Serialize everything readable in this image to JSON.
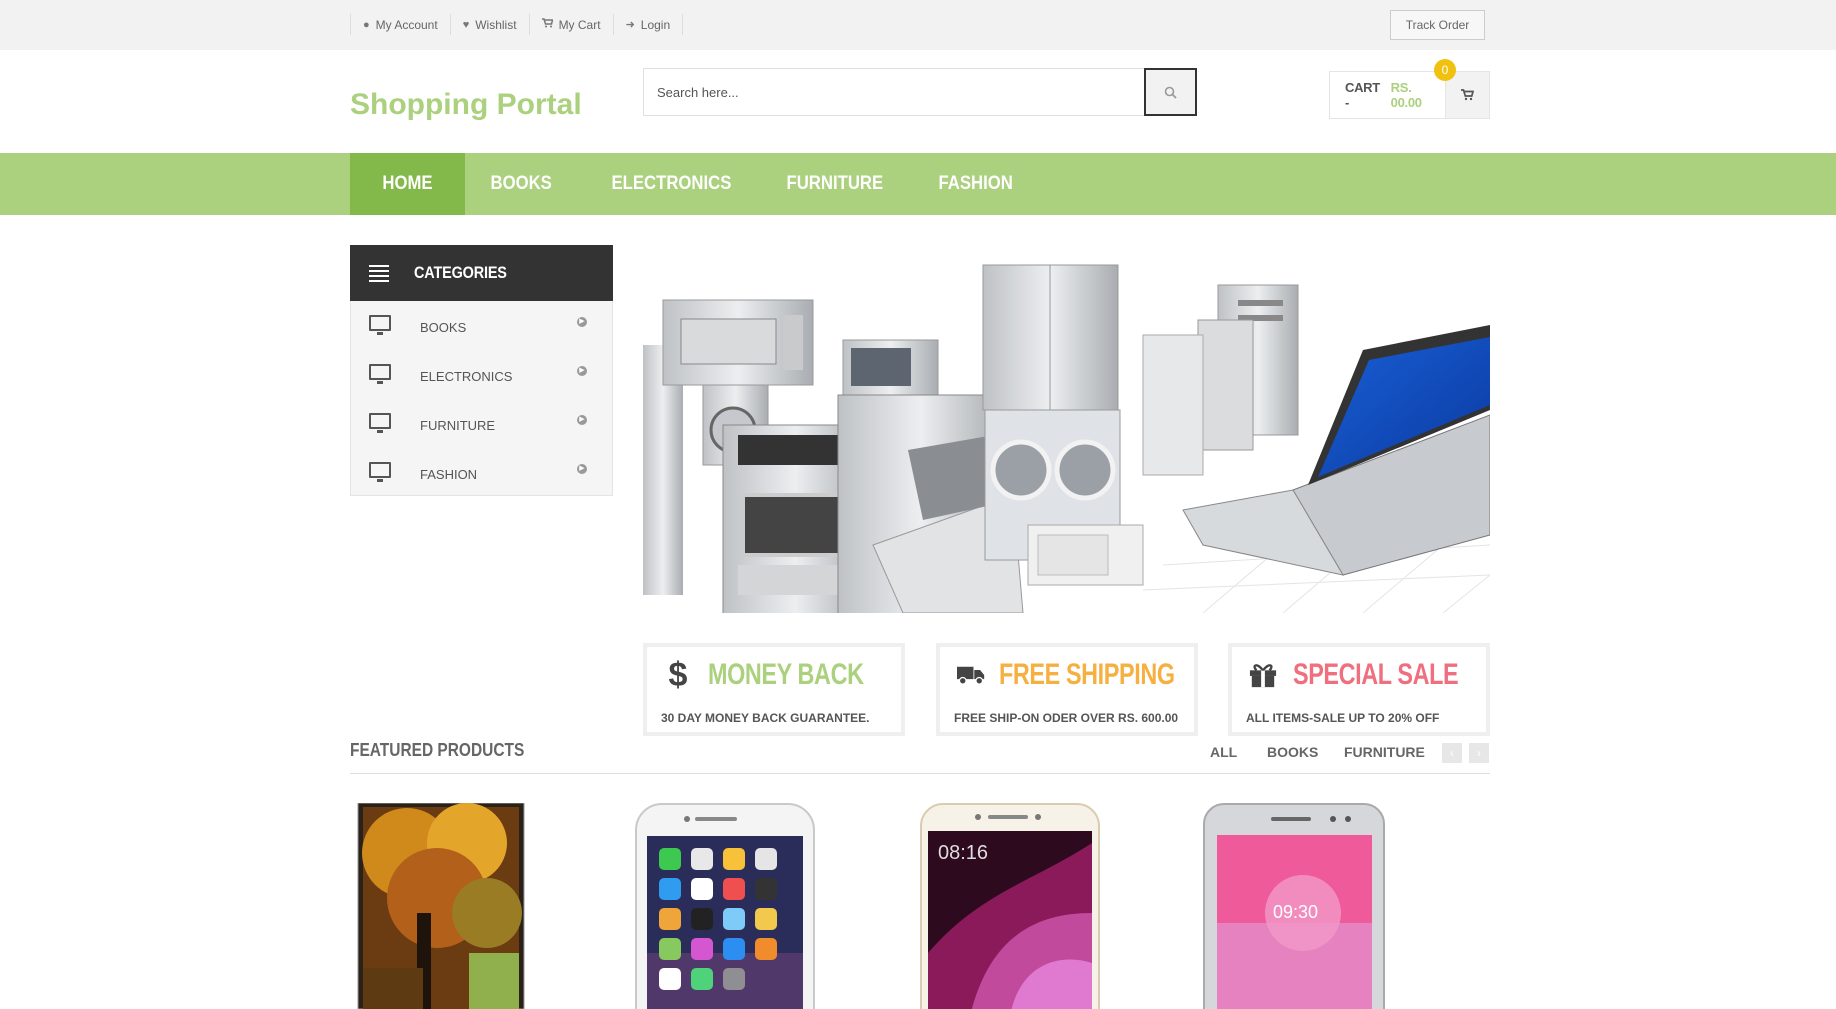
{
  "topbar": {
    "links": [
      {
        "label": "My Account",
        "icon": "user-icon"
      },
      {
        "label": "Wishlist",
        "icon": "heart-icon"
      },
      {
        "label": "My Cart",
        "icon": "cart-icon"
      },
      {
        "label": "Login",
        "icon": "login-icon"
      }
    ],
    "track_order": "Track Order"
  },
  "header": {
    "logo": "Shopping Portal",
    "search_placeholder": "Search here...",
    "cart_label": "CART -",
    "cart_amount": "RS. 00.00",
    "cart_count": "0"
  },
  "nav": {
    "items": [
      "HOME",
      "BOOKS",
      "ELECTRONICS",
      "FURNITURE",
      "FASHION"
    ]
  },
  "sidebar": {
    "title": "CATEGORIES",
    "items": [
      "BOOKS",
      "ELECTRONICS",
      "FURNITURE",
      "FASHION"
    ]
  },
  "info_boxes": [
    {
      "title": "MONEY BACK",
      "text": "30 DAY MONEY BACK GUARANTEE.",
      "icon": "dollar-icon",
      "color": "#abd07e"
    },
    {
      "title": "FREE SHIPPING",
      "text": "FREE SHIP-ON ODER OVER RS. 600.00",
      "icon": "truck-icon",
      "color": "#f5b041"
    },
    {
      "title": "SPECIAL SALE",
      "text": "ALL ITEMS-SALE UP TO 20% OFF",
      "icon": "gift-icon",
      "color": "#ef6f7e"
    }
  ],
  "featured": {
    "title": "FEATURED PRODUCTS",
    "filters": [
      "ALL",
      "BOOKS",
      "FURNITURE"
    ]
  },
  "colors": {
    "brand_green": "#abd07e",
    "nav_active": "#83b94a",
    "badge_yellow": "#f0c20f"
  }
}
